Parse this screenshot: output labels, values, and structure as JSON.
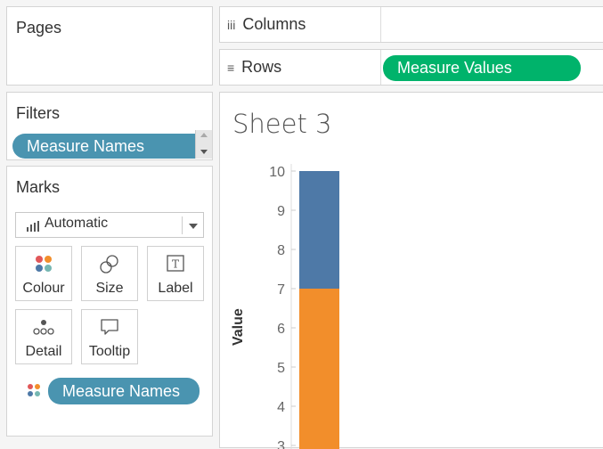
{
  "pages": {
    "title": "Pages"
  },
  "filters": {
    "title": "Filters",
    "pill": "Measure Names"
  },
  "marks": {
    "title": "Marks",
    "mark_type": "Automatic",
    "buttons": [
      {
        "label": "Colour",
        "icon": "colour-icon"
      },
      {
        "label": "Size",
        "icon": "size-icon"
      },
      {
        "label": "Label",
        "icon": "label-icon"
      },
      {
        "label": "Detail",
        "icon": "detail-icon"
      },
      {
        "label": "Tooltip",
        "icon": "tooltip-icon"
      }
    ],
    "colour_pill": "Measure Names"
  },
  "shelves": {
    "columns_label": "Columns",
    "rows_label": "Rows",
    "rows_pill": "Measure Values"
  },
  "sheet": {
    "title": "Sheet 3"
  },
  "colors": {
    "blue_series": "#4e79a7",
    "orange_series": "#f28e2b",
    "pill_blue": "#4a94b0",
    "pill_green": "#00b36b"
  },
  "chart_data": {
    "type": "bar",
    "stacked": true,
    "ylabel": "Value",
    "y_ticks": [
      "10",
      "9",
      "8",
      "7",
      "6",
      "5",
      "4",
      "3"
    ],
    "segments": [
      {
        "from": 0,
        "to": 7,
        "color": "#f28e2b"
      },
      {
        "from": 7,
        "to": 10,
        "color": "#4e79a7"
      }
    ]
  }
}
